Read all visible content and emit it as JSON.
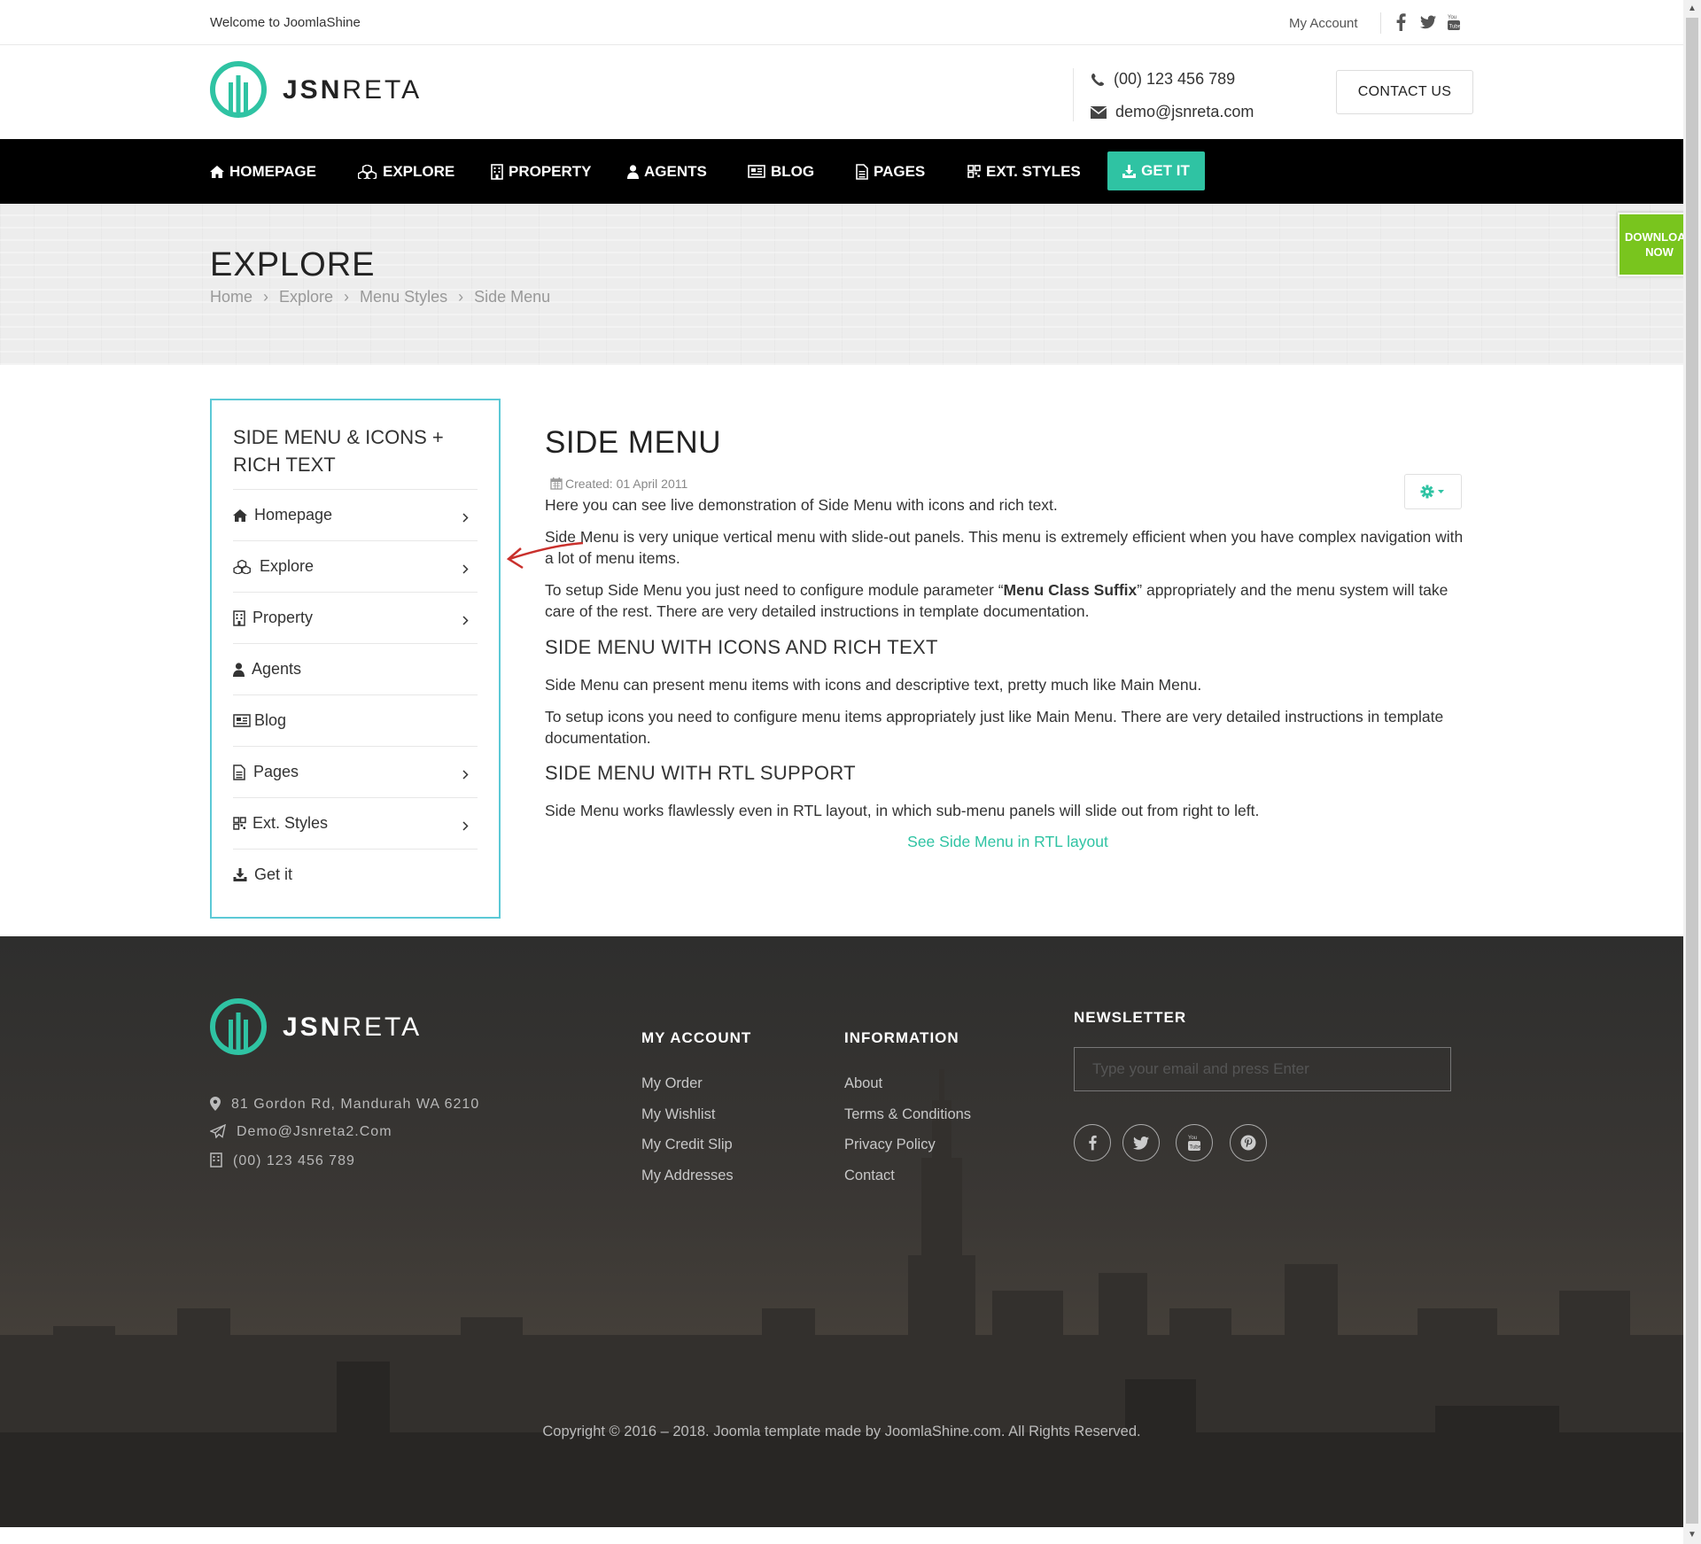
{
  "topbar": {
    "welcome": "Welcome to JoomlaShine",
    "account": "My Account",
    "social_icons": [
      "facebook-icon",
      "twitter-icon",
      "youtube-icon"
    ]
  },
  "header": {
    "logo_bold": "JSN",
    "logo_light": "RETA",
    "phone": "(00) 123 456 789",
    "email": "demo@jsnreta.com",
    "contact_button": "CONTACT US"
  },
  "nav": {
    "items": [
      {
        "label": "HOMEPAGE",
        "icon": "home-icon"
      },
      {
        "label": "EXPLORE",
        "icon": "cubes-icon"
      },
      {
        "label": "PROPERTY",
        "icon": "building-icon"
      },
      {
        "label": "AGENTS",
        "icon": "user-icon"
      },
      {
        "label": "BLOG",
        "icon": "newspaper-icon"
      },
      {
        "label": "PAGES",
        "icon": "file-icon"
      },
      {
        "label": "EXT. STYLES",
        "icon": "grid-icon"
      }
    ],
    "cta": "GET IT",
    "accent": "#2fc3a3"
  },
  "banner": {
    "title": "EXPLORE",
    "breadcrumb": [
      "Home",
      "Explore",
      "Menu Styles",
      "Side Menu"
    ]
  },
  "download_badge": {
    "line1": "DOWNLOAD",
    "line2": "NOW",
    "color": "#79c51e"
  },
  "sidebar": {
    "title": "SIDE MENU & ICONS + RICH TEXT",
    "items": [
      {
        "label": "Homepage",
        "icon": "home-icon",
        "has_submenu": true
      },
      {
        "label": "Explore",
        "icon": "cubes-icon",
        "has_submenu": true
      },
      {
        "label": "Property",
        "icon": "building-icon",
        "has_submenu": true
      },
      {
        "label": "Agents",
        "icon": "user-icon",
        "has_submenu": false
      },
      {
        "label": "Blog",
        "icon": "newspaper-icon",
        "has_submenu": false
      },
      {
        "label": "Pages",
        "icon": "file-icon",
        "has_submenu": true
      },
      {
        "label": "Ext. Styles",
        "icon": "grid-icon",
        "has_submenu": true
      },
      {
        "label": "Get it",
        "icon": "download-icon",
        "has_submenu": false
      }
    ],
    "border_color": "#5cc9d6"
  },
  "article": {
    "title": "SIDE MENU",
    "created": "Created: 01 April 2011",
    "p1": "Here you can see live demonstration of Side Menu with icons and rich text.",
    "p2": "Side Menu is very unique vertical menu with slide-out panels. This menu is extremely efficient when you have complex navigation with a lot of menu items.",
    "p3_before": "To setup Side Menu you just need to configure module parameter “",
    "p3_bold": "Menu Class Suffix",
    "p3_after": "” appropriately and the menu system will take care of the rest. There are very detailed instructions in template documentation.",
    "h2_icons": "SIDE MENU WITH ICONS AND RICH TEXT",
    "p4": "Side Menu can present menu items with icons and descriptive text, pretty much like Main Menu.",
    "p5": "To setup icons you need to configure menu items appropriately just like Main Menu. There are very detailed instructions in template documentation.",
    "h2_rtl": "SIDE MENU WITH RTL SUPPORT",
    "p6": "Side Menu works flawlessly even in RTL layout, in which sub-menu panels will slide out from right to left.",
    "rtl_link": "See Side Menu in RTL layout"
  },
  "footer": {
    "logo_bold": "JSN",
    "logo_light": "RETA",
    "address": "81 Gordon Rd, Mandurah WA 6210",
    "email": "Demo@Jsnreta2.Com",
    "phone": "(00) 123 456 789",
    "my_account": {
      "heading": "MY ACCOUNT",
      "links": [
        "My Order",
        "My Wishlist",
        "My Credit Slip",
        "My Addresses"
      ]
    },
    "information": {
      "heading": "INFORMATION",
      "links": [
        "About",
        "Terms & Conditions",
        "Privacy Policy",
        "Contact"
      ]
    },
    "newsletter": {
      "heading": "NEWSLETTER",
      "placeholder": "Type your email and press Enter",
      "social_icons": [
        "facebook-icon",
        "twitter-icon",
        "youtube-icon",
        "pinterest-icon"
      ]
    },
    "copyright": "Copyright © 2016 – 2018. Joomla template made by JoomlaShine.com. All Rights Reserved."
  }
}
